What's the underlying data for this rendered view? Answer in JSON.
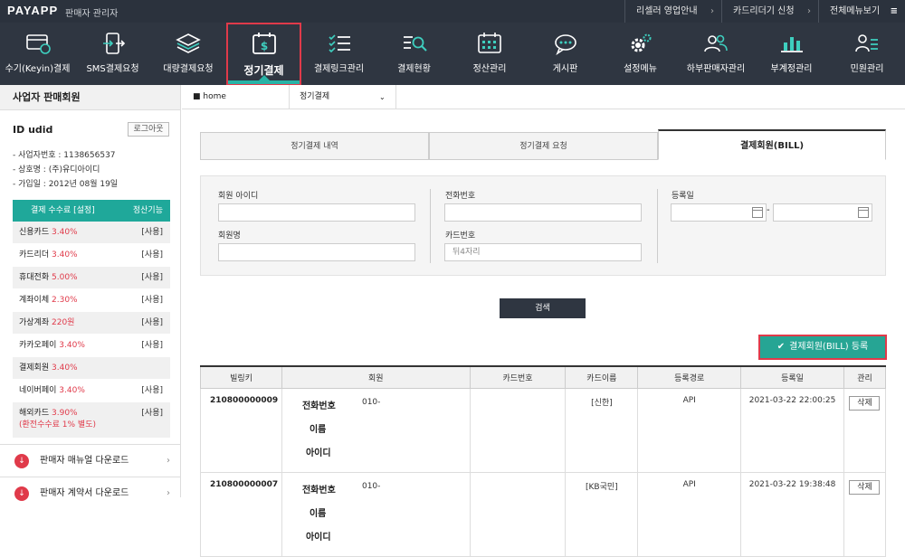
{
  "app": {
    "logo": "PAYAPP",
    "subtitle": "판매자 관리자"
  },
  "top_links": [
    {
      "label": "리셀러 영업안내",
      "chev": "›"
    },
    {
      "label": "카드리더기 신청",
      "chev": "›"
    },
    {
      "label": "전체메뉴보기",
      "chev": "≡"
    }
  ],
  "nav": [
    {
      "label": "수기(Keyin)결제",
      "icon": "card-icon"
    },
    {
      "label": "SMS결제요청",
      "icon": "mobile-send-icon"
    },
    {
      "label": "대량결제요청",
      "icon": "layers-icon"
    },
    {
      "label": "정기결제",
      "icon": "calendar-dollar-icon",
      "active": true
    },
    {
      "label": "결제링크관리",
      "icon": "checklist-icon"
    },
    {
      "label": "결제현황",
      "icon": "search-list-icon"
    },
    {
      "label": "정산관리",
      "icon": "calendar-grid-icon"
    },
    {
      "label": "게시판",
      "icon": "chat-icon"
    },
    {
      "label": "설정메뉴",
      "icon": "gear-icon"
    },
    {
      "label": "하부판매자관리",
      "icon": "users-icon"
    },
    {
      "label": "부계정관리",
      "icon": "bar-chart-icon"
    },
    {
      "label": "민원관리",
      "icon": "person-list-icon"
    }
  ],
  "sidebar": {
    "title": "사업자 판매회원",
    "id_label": "ID",
    "id_value": "udid",
    "logout": "로그아웃",
    "info": [
      "- 사업자번호 : 1138656537",
      "- 상호명 : (주)유디아이디",
      "- 가입일 : 2012년 08월 19일"
    ],
    "fee_header": {
      "left": "결제 수수료 [설정]",
      "right": "정산기능"
    },
    "fees": [
      {
        "name": "신용카드",
        "pct": "3.40%",
        "use": "[사용]"
      },
      {
        "name": "카드리더",
        "pct": "3.40%",
        "use": "[사용]"
      },
      {
        "name": "휴대전화",
        "pct": "5.00%",
        "use": "[사용]"
      },
      {
        "name": "계좌이체",
        "pct": "2.30%",
        "use": "[사용]"
      },
      {
        "name": "가상계좌",
        "pct": "220원",
        "use": "[사용]"
      },
      {
        "name": "카카오페이",
        "pct": "3.40%",
        "use": "[사용]"
      },
      {
        "name": "결제회원",
        "pct": "3.40%",
        "use": ""
      },
      {
        "name": "네이버페이",
        "pct": "3.40%",
        "use": "[사용]"
      },
      {
        "name": "해외카드",
        "pct": "3.90%",
        "use": "[사용]",
        "note": "(환전수수료 1% 별도)"
      }
    ],
    "downloads": [
      {
        "label": "판매자 매뉴얼 다운로드",
        "icon": "download-icon"
      },
      {
        "label": "판매자 계약서 다운로드",
        "icon": "download-icon"
      }
    ]
  },
  "breadcrumb": {
    "home": "home",
    "current": "정기결제",
    "dropdown": "⌄"
  },
  "tabs": [
    "정기결제 내역",
    "정기결제 요청",
    "결제회원(BILL)"
  ],
  "form": {
    "member_id_label": "회원 아이디",
    "member_id_value": "",
    "phone_label": "전화번호",
    "phone_value": "",
    "reg_date_label": "등록일",
    "date_from": "",
    "date_to": "",
    "date_sep": "-",
    "member_name_label": "회원명",
    "member_name_value": "",
    "card_label": "카드번호",
    "card_placeholder": "뒤4자리"
  },
  "search_button": "검색",
  "register_button": "결제회원(BILL) 등록",
  "table": {
    "headers": [
      "빌링키",
      "회원",
      "카드번호",
      "카드이름",
      "등록경로",
      "등록일",
      "관리"
    ],
    "rows": [
      {
        "billkey": "210800000009",
        "phone_label": "전화번호",
        "phone": "010-",
        "name_label": "이름",
        "name": "",
        "id_label": "아이디",
        "id": "",
        "card_no": "",
        "card_name": "[신한]",
        "route": "API",
        "date": "2021-03-22 22:00:25",
        "action": "삭제"
      },
      {
        "billkey": "210800000007",
        "phone_label": "전화번호",
        "phone": "010-",
        "name_label": "이름",
        "name": "",
        "id_label": "아이디",
        "id": "",
        "card_no": "",
        "card_name": "[KB국민]",
        "route": "API",
        "date": "2021-03-22 19:38:48",
        "action": "삭제"
      }
    ]
  }
}
